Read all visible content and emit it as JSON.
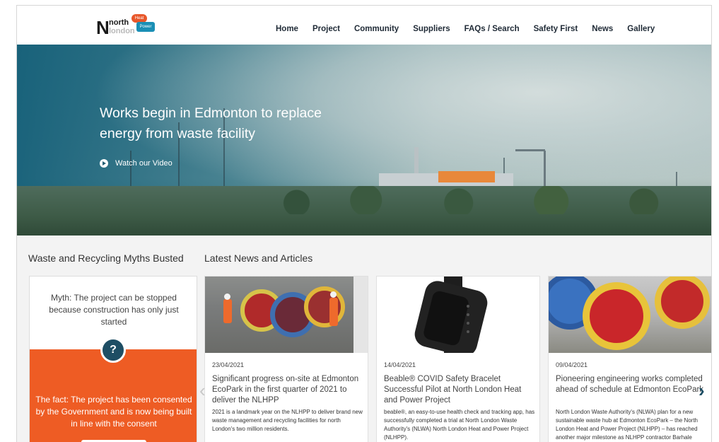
{
  "logo": {
    "line1": "north",
    "line2": "london",
    "badge_top": "Heat and",
    "badge_bottom": "Power"
  },
  "nav": {
    "items": [
      "Home",
      "Project",
      "Community",
      "Suppliers",
      "FAQs / Search",
      "Safety First",
      "News",
      "Gallery"
    ]
  },
  "hero": {
    "headline": "Works begin in Edmonton to replace energy from waste facility",
    "video_label": "Watch our Video"
  },
  "myths": {
    "section_title": "Waste and Recycling Myths Busted",
    "question": "Myth: The project can be stopped because construction has only just started",
    "badge": "?",
    "fact": "The fact: The project has been consented by the Government and is now being built in line with the consent"
  },
  "news": {
    "section_title": "Latest News and Articles",
    "articles": [
      {
        "date": "23/04/2021",
        "title": "Significant progress on-site at Edmonton EcoPark in the first quarter of 2021 to deliver the NLHPP",
        "body": "2021 is a landmark year on the NLHPP to deliver brand new waste management and recycling facilities for north London's two million residents."
      },
      {
        "date": "14/04/2021",
        "title": "Beable® COVID Safety Bracelet Successful Pilot at North London Heat and Power Project",
        "body": "beable®, an easy-to-use health check and tracking app, has successfully completed a trial at North London Waste Authority's (NLWA) North London Heat and Power Project (NLHPP)."
      },
      {
        "date": "09/04/2021",
        "title": "Pioneering engineering works completed ahead of schedule at Edmonton EcoPark",
        "body": "North London Waste Authority's (NLWA) plan for a new sustainable waste hub at Edmonton EcoPark – the North London Heat and Power Project (NLHPP) – has reached another major milestone as NLHPP contractor Barhale completes complex engineering works to make way for"
      }
    ],
    "prev_arrow": "‹",
    "next_arrow": "›"
  },
  "colors": {
    "accent_orange": "#ee5c24",
    "navy": "#1e4e64",
    "nav_text": "#1f2a36"
  }
}
